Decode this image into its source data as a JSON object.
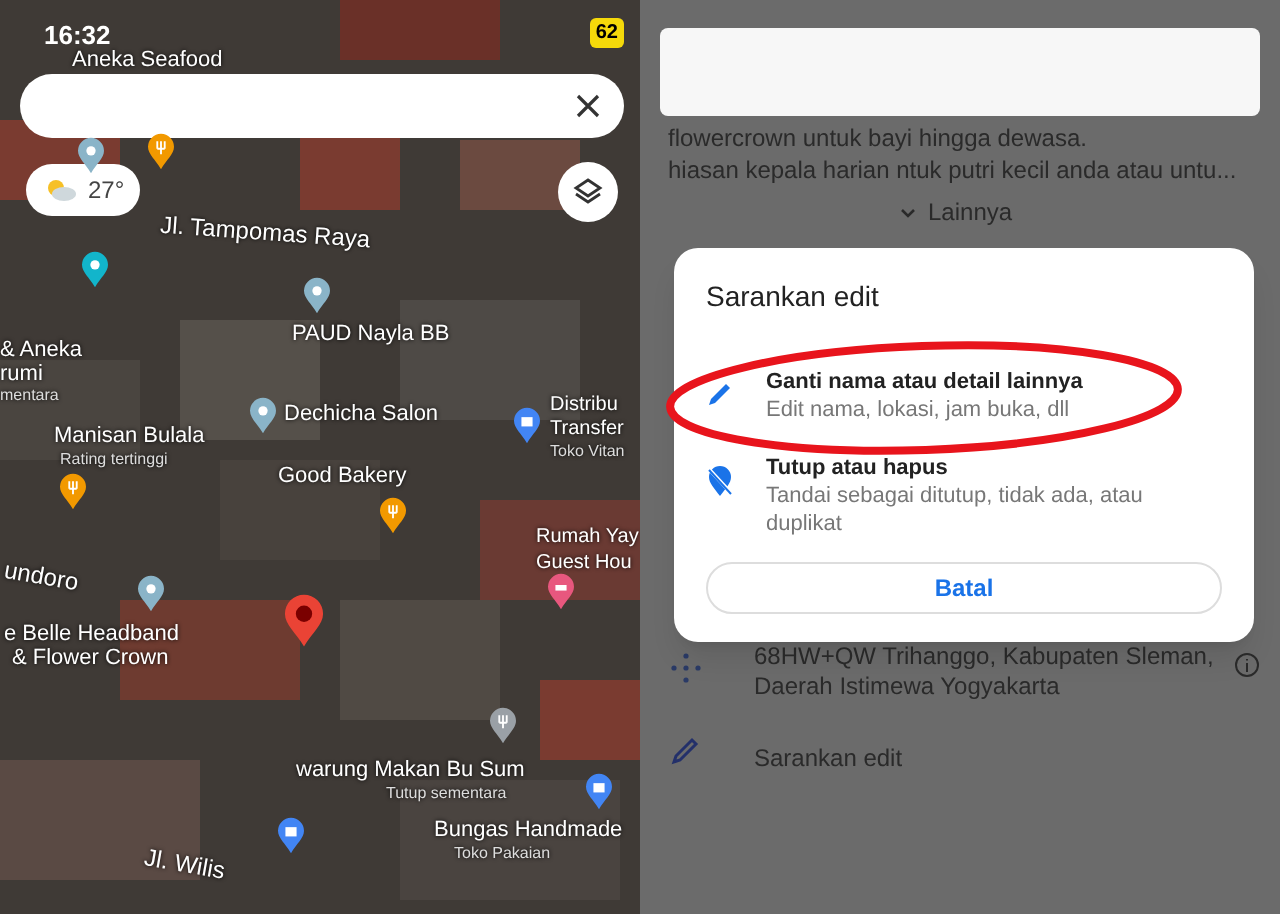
{
  "status_bar": {
    "time": "16:32",
    "battery": "62"
  },
  "map": {
    "weather": "27°",
    "labels": [
      {
        "text": "Aneka Seafood",
        "kind": "place"
      },
      {
        "text": "Jl. Tampomas Raya",
        "kind": "road"
      },
      {
        "text": "PAUD Nayla BB",
        "kind": "place"
      },
      {
        "text": "& Aneka",
        "kind": "place"
      },
      {
        "text": "rumi",
        "kind": "place"
      },
      {
        "text": "mentara",
        "kind": "sub"
      },
      {
        "text": "Manisan Bulala",
        "kind": "place"
      },
      {
        "text": "Rating tertinggi",
        "kind": "sub"
      },
      {
        "text": "Dechicha Salon",
        "kind": "place"
      },
      {
        "text": "Distribu",
        "kind": "place"
      },
      {
        "text": "Transfer",
        "kind": "place"
      },
      {
        "text": "Toko Vitan",
        "kind": "sub"
      },
      {
        "text": "Good Bakery",
        "kind": "place"
      },
      {
        "text": "Rumah Yay",
        "kind": "place"
      },
      {
        "text": "Guest Hou",
        "kind": "place"
      },
      {
        "text": "undoro",
        "kind": "road"
      },
      {
        "text": "e Belle Headband",
        "kind": "place"
      },
      {
        "text": "& Flower Crown",
        "kind": "place"
      },
      {
        "text": "warung Makan Bu Sum",
        "kind": "place"
      },
      {
        "text": "Tutup sementara",
        "kind": "sub"
      },
      {
        "text": "Bungas Handmade",
        "kind": "place"
      },
      {
        "text": "Toko Pakaian",
        "kind": "sub"
      },
      {
        "text": "Jl. Wilis",
        "kind": "road"
      }
    ],
    "markers": [
      {
        "kind": "food",
        "color": "#f29900"
      },
      {
        "kind": "generic",
        "color": "#8ab4c8"
      },
      {
        "kind": "generic",
        "color": "#12b5cb"
      },
      {
        "kind": "generic",
        "color": "#8ab4c8"
      },
      {
        "kind": "shop",
        "color": "#4285f4"
      },
      {
        "kind": "generic",
        "color": "#8ab4c8"
      },
      {
        "kind": "food",
        "color": "#f29900"
      },
      {
        "kind": "food",
        "color": "#f29900"
      },
      {
        "kind": "generic",
        "color": "#8ab4c8"
      },
      {
        "kind": "hotel",
        "color": "#e8577e"
      },
      {
        "kind": "food",
        "color": "#9aa0a6"
      },
      {
        "kind": "shop",
        "color": "#4285f4"
      },
      {
        "kind": "shop",
        "color": "#4285f4"
      },
      {
        "kind": "pin",
        "color": "#ea4335"
      }
    ]
  },
  "sheet": {
    "description": [
      "flowercrown untuk bayi hingga dewasa.",
      "hiasan kepala harian ntuk putri kecil anda atau untu..."
    ],
    "more": "Lainnya",
    "address": "68HW+QW Trihanggo, Kabupaten Sleman, Daerah Istimewa Yogyakarta",
    "suggest": "Sarankan edit"
  },
  "dialog": {
    "title": "Sarankan edit",
    "options": [
      {
        "kind": "edit",
        "title": "Ganti nama atau detail lainnya",
        "subtitle": "Edit nama, lokasi, jam buka, dll",
        "circled": true
      },
      {
        "kind": "close",
        "title": "Tutup atau hapus",
        "subtitle": "Tandai sebagai ditutup, tidak ada, atau duplikat",
        "circled": false
      }
    ],
    "cancel": "Batal"
  }
}
